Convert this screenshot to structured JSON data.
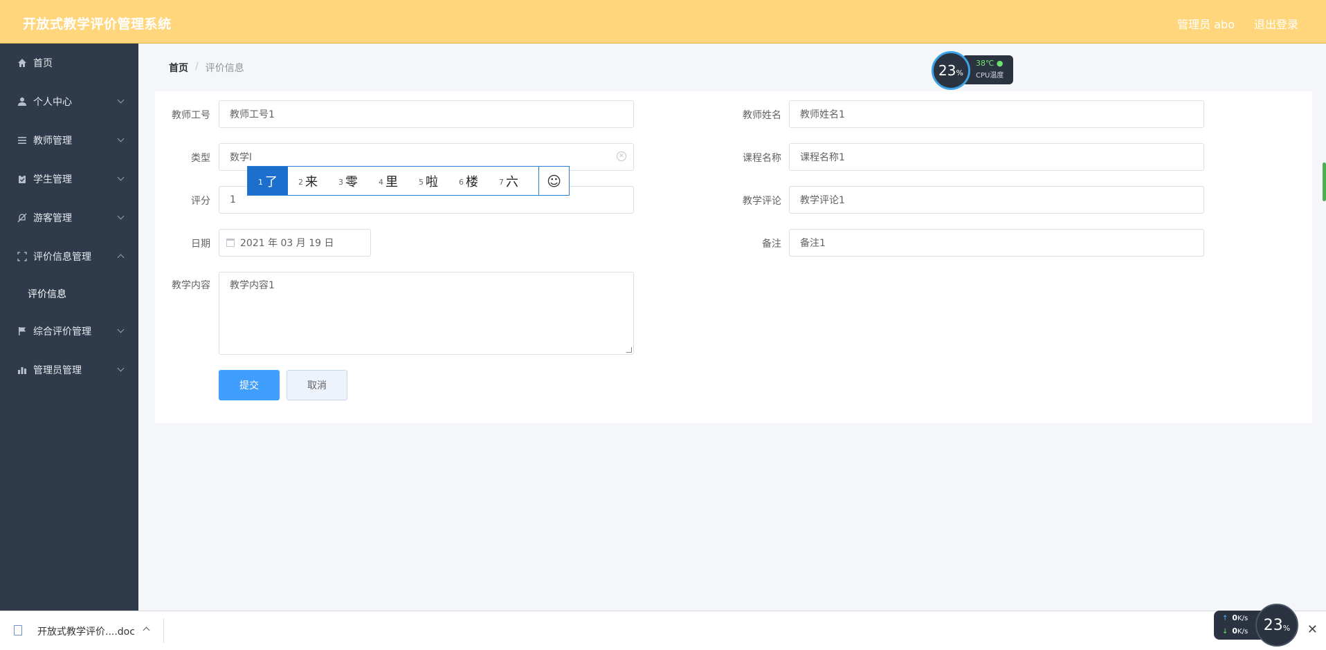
{
  "header": {
    "app_title": "开放式教学评价管理系统",
    "user_label": "管理员 abo",
    "logout_label": "退出登录"
  },
  "sidebar": {
    "items": [
      {
        "label": "首页",
        "icon": "home-icon"
      },
      {
        "label": "个人中心",
        "icon": "user-icon"
      },
      {
        "label": "教师管理",
        "icon": "list-icon"
      },
      {
        "label": "学生管理",
        "icon": "clipboard-icon"
      },
      {
        "label": "游客管理",
        "icon": "bell-off-icon"
      },
      {
        "label": "评价信息管理",
        "icon": "frame-icon"
      },
      {
        "label": "综合评价管理",
        "icon": "flag-icon"
      },
      {
        "label": "管理员管理",
        "icon": "bar-chart-icon"
      }
    ],
    "sub_item": "评价信息"
  },
  "breadcrumb": {
    "home": "首页",
    "separator": "/",
    "current": "评价信息"
  },
  "form": {
    "teacher_id_label": "教师工号",
    "teacher_id_value": "教师工号1",
    "teacher_name_label": "教师姓名",
    "teacher_name_value": "教师姓名1",
    "type_label": "类型",
    "type_value": "数学l",
    "course_label": "课程名称",
    "course_value": "课程名称1",
    "score_label": "评分",
    "score_value": "1",
    "comment_label": "教学评论",
    "comment_value": "教学评论1",
    "date_label": "日期",
    "date_value": "2021 年 03 月 19 日",
    "remark_label": "备注",
    "remark_value": "备注1",
    "content_label": "教学内容",
    "content_value": "教学内容1",
    "submit_label": "提交",
    "cancel_label": "取消"
  },
  "ime": {
    "candidates": [
      {
        "num": "1",
        "text": "了"
      },
      {
        "num": "2",
        "text": "来"
      },
      {
        "num": "3",
        "text": "零"
      },
      {
        "num": "4",
        "text": "里"
      },
      {
        "num": "5",
        "text": "啦"
      },
      {
        "num": "6",
        "text": "楼"
      },
      {
        "num": "7",
        "text": "六"
      }
    ],
    "emoji": "☺"
  },
  "cpu_widget": {
    "usage": "23",
    "unit": "%",
    "temp": "38℃",
    "label": "CPU温度"
  },
  "download_bar": {
    "file_name": "开放式教学评价....doc",
    "close": "✕"
  },
  "net_widget": {
    "up": "0",
    "down": "0",
    "unit": "K/s",
    "usage": "23",
    "usage_unit": "%"
  },
  "colors": {
    "header_bg": "#ffd67c",
    "sidebar_bg": "#2f3a4b",
    "primary": "#409eff"
  }
}
